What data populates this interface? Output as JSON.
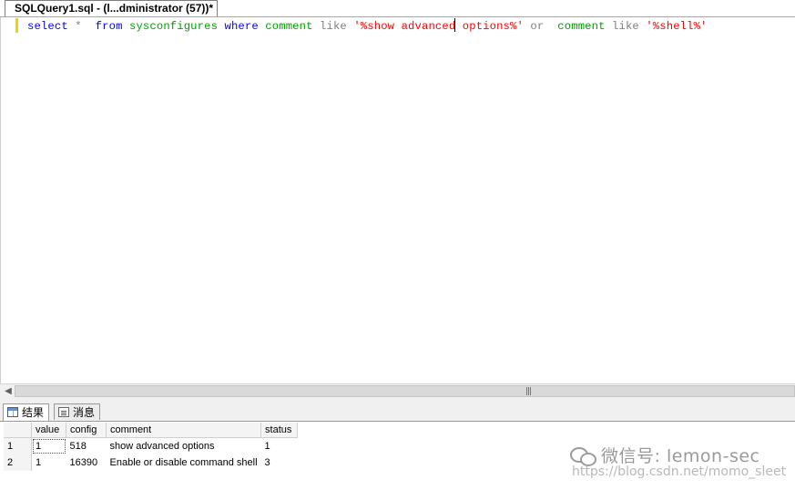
{
  "document_tab": {
    "title": "SQLQuery1.sql - (l...dministrator (57))*"
  },
  "editor": {
    "tokens": {
      "select": "select",
      "star": "*",
      "from": "from",
      "table": "sysconfigures",
      "where": "where",
      "col1": "comment",
      "like1": "like",
      "str1_before_caret": "'%show advanced",
      "str1_after_caret": " options%'",
      "or": "or",
      "col2": "comment",
      "like2": "like",
      "str2": "'%shell%'"
    }
  },
  "results_tabs": [
    {
      "label": "结果",
      "icon": "results-grid-icon",
      "active": true
    },
    {
      "label": "消息",
      "icon": "messages-icon",
      "active": false
    }
  ],
  "results_grid": {
    "columns": [
      "value",
      "config",
      "comment",
      "status"
    ],
    "rows": [
      {
        "row_number": "1",
        "value": "1",
        "config": "518",
        "comment": "show advanced options",
        "status": "1"
      },
      {
        "row_number": "2",
        "value": "1",
        "config": "16390",
        "comment": "Enable or disable command shell",
        "status": "3"
      }
    ]
  },
  "watermark": {
    "wechat_text": "微信号: lemon-sec",
    "url_text": "https://blog.csdn.net/momo_sleet"
  },
  "colors": {
    "keyword": "#0000ff",
    "operator": "#808080",
    "object": "#00a000",
    "string": "#ff0000",
    "change_bar": "#f4d400"
  }
}
